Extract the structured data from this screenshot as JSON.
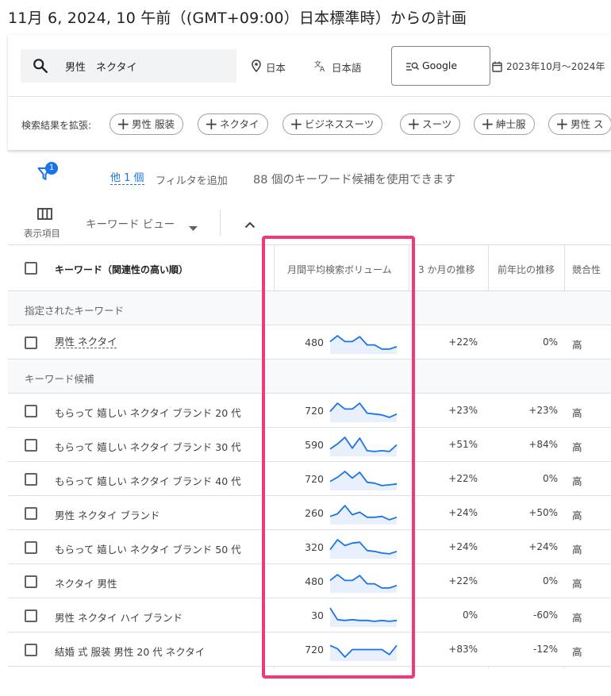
{
  "header": {
    "title": "11月 6, 2024, 10 午前（(GMT+09:00）日本標準時）からの計画"
  },
  "search": {
    "query": "男性　ネクタイ",
    "location": "日本",
    "language": "日本語",
    "network": "Google",
    "date_range": "2023年10月～2024年"
  },
  "expand": {
    "label": "検索結果を拡張:",
    "chips": [
      "男性 服装",
      "ネクタイ",
      "ビジネススーツ",
      "スーツ",
      "紳士服",
      "男性 ス"
    ]
  },
  "filter": {
    "badge_count": "1",
    "more_link": "他 1 個",
    "add_filter": "フィルタを追加",
    "keyword_count_text": "88 個のキーワード候補を使用できます"
  },
  "toolbar": {
    "columns_label": "表示項目",
    "view_label": "キーワード ビュー"
  },
  "table": {
    "columns": {
      "keyword": "キーワード（関連性の高い順）",
      "volume": "月間平均検索ボリューム",
      "trend3": "3 か月の推移",
      "yoy": "前年比の推移",
      "competition": "競合性"
    },
    "sections": {
      "specified": "指定されたキーワード",
      "ideas": "キーワード候補"
    },
    "specified_rows": [
      {
        "keyword": "男性 ネクタイ",
        "volume": "480",
        "trend3": "+22%",
        "yoy": "0%",
        "competition": "高",
        "spark": [
          0.55,
          0.9,
          0.55,
          0.55,
          0.85,
          0.35,
          0.35,
          0.1,
          0.1,
          0.25
        ]
      }
    ],
    "idea_rows": [
      {
        "keyword": "もらって 嬉しい ネクタイ ブランド 20 代",
        "volume": "720",
        "trend3": "+23%",
        "yoy": "+23%",
        "competition": "高",
        "spark": [
          0.45,
          0.95,
          0.6,
          0.6,
          0.95,
          0.35,
          0.3,
          0.25,
          0.1,
          0.3
        ]
      },
      {
        "keyword": "もらって 嬉しい ネクタイ ブランド 30 代",
        "volume": "590",
        "trend3": "+51%",
        "yoy": "+84%",
        "competition": "高",
        "spark": [
          0.25,
          0.55,
          0.95,
          0.3,
          0.9,
          0.15,
          0.1,
          0.15,
          0.1,
          0.5
        ]
      },
      {
        "keyword": "もらって 嬉しい ネクタイ ブランド 40 代",
        "volume": "720",
        "trend3": "+22%",
        "yoy": "0%",
        "competition": "高",
        "spark": [
          0.35,
          0.6,
          0.95,
          0.55,
          0.9,
          0.3,
          0.25,
          0.1,
          0.15,
          0.2
        ]
      },
      {
        "keyword": "男性 ネクタイ ブランド",
        "volume": "260",
        "trend3": "+24%",
        "yoy": "+50%",
        "competition": "高",
        "spark": [
          0.3,
          0.45,
          0.95,
          0.4,
          0.55,
          0.25,
          0.25,
          0.3,
          0.1,
          0.25
        ]
      },
      {
        "keyword": "もらって 嬉しい ネクタイ ブランド 50 代",
        "volume": "320",
        "trend3": "+24%",
        "yoy": "+24%",
        "competition": "高",
        "spark": [
          0.35,
          0.95,
          0.6,
          0.75,
          0.8,
          0.3,
          0.25,
          0.15,
          0.1,
          0.25
        ]
      },
      {
        "keyword": "ネクタイ 男性",
        "volume": "480",
        "trend3": "+22%",
        "yoy": "0%",
        "competition": "高",
        "spark": [
          0.55,
          0.9,
          0.55,
          0.55,
          0.85,
          0.35,
          0.35,
          0.1,
          0.1,
          0.25
        ]
      },
      {
        "keyword": "男性 ネクタイ ハイ ブランド",
        "volume": "30",
        "trend3": "0%",
        "yoy": "-60%",
        "competition": "高",
        "spark": [
          0.95,
          0.25,
          0.2,
          0.25,
          0.2,
          0.2,
          0.15,
          0.2,
          0.15,
          0.2
        ]
      },
      {
        "keyword": "結婚 式 服装 男性 20 代 ネクタイ",
        "volume": "720",
        "trend3": "+83%",
        "yoy": "-12%",
        "competition": "高",
        "spark": [
          0.75,
          0.55,
          0.05,
          0.5,
          0.5,
          0.5,
          0.5,
          0.5,
          0.2,
          0.75
        ]
      }
    ]
  },
  "colors": {
    "accent": "#1a73e8",
    "highlight_border": "#ef3a77",
    "spark_line": "#1a73e8",
    "spark_fill": "#e8f0fe"
  }
}
